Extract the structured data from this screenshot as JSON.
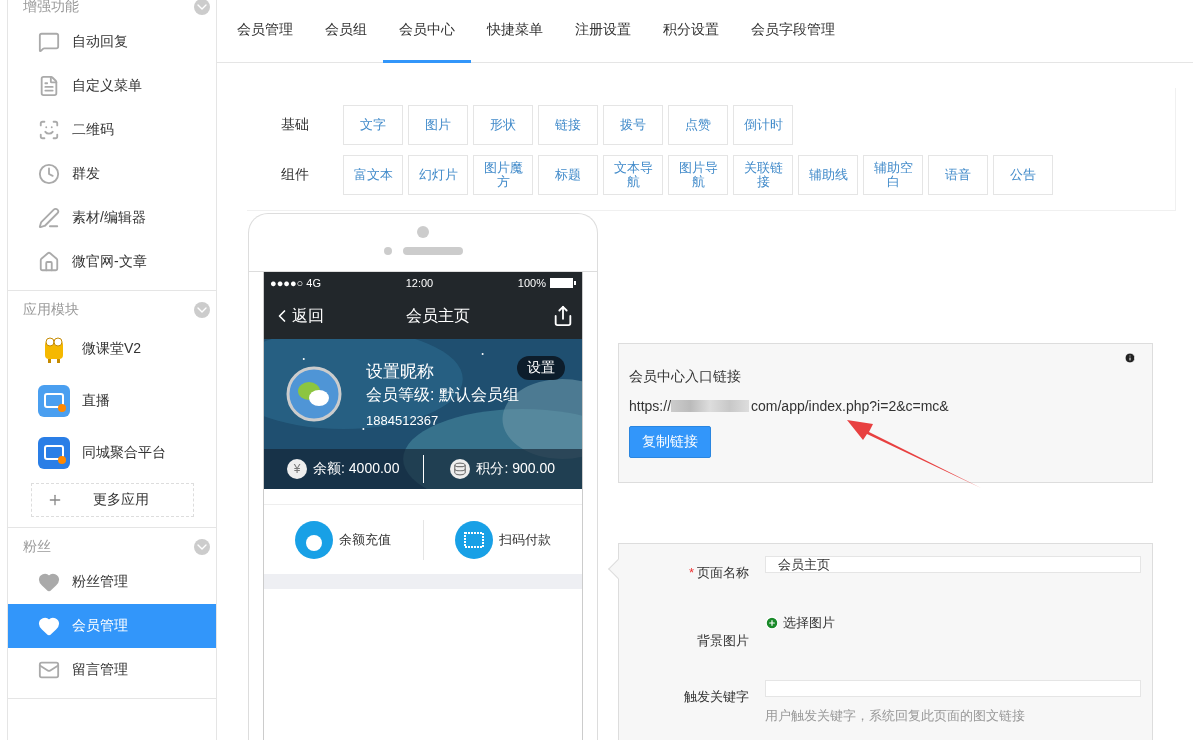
{
  "sidebar": {
    "sections": [
      {
        "title": "增强功能",
        "items": [
          {
            "kind": "menu",
            "label": "自动回复",
            "selected": false
          },
          {
            "kind": "menu",
            "label": "自定义菜单",
            "selected": false
          },
          {
            "kind": "menu",
            "label": "二维码",
            "selected": false
          },
          {
            "kind": "menu",
            "label": "群发",
            "selected": false
          },
          {
            "kind": "menu",
            "label": "素材/编辑器",
            "selected": false
          },
          {
            "kind": "menu",
            "label": "微官网-文章",
            "selected": false
          }
        ]
      },
      {
        "title": "应用模块",
        "items": [
          {
            "kind": "app",
            "label": "微课堂V2",
            "selected": false
          },
          {
            "kind": "app",
            "label": "直播",
            "selected": false
          },
          {
            "kind": "app",
            "label": "同城聚合平台",
            "selected": false
          },
          {
            "kind": "add",
            "label": "更多应用",
            "selected": false
          }
        ]
      },
      {
        "title": "粉丝",
        "items": [
          {
            "kind": "menu",
            "label": "粉丝管理",
            "selected": false
          },
          {
            "kind": "menu",
            "label": "会员管理",
            "selected": true
          },
          {
            "kind": "menu",
            "label": "留言管理",
            "selected": false
          }
        ]
      }
    ]
  },
  "tabs": [
    {
      "label": "会员管理",
      "selected": false
    },
    {
      "label": "会员组",
      "selected": false
    },
    {
      "label": "会员中心",
      "selected": true
    },
    {
      "label": "快捷菜单",
      "selected": false
    },
    {
      "label": "注册设置",
      "selected": false
    },
    {
      "label": "积分设置",
      "selected": false
    },
    {
      "label": "会员字段管理",
      "selected": false
    }
  ],
  "palette": [
    {
      "label": "基础",
      "items": [
        "文字",
        "图片",
        "形状",
        "链接",
        "拨号",
        "点赞",
        "倒计时"
      ]
    },
    {
      "label": "组件",
      "items": [
        "富文本",
        "幻灯片",
        "图片魔方",
        "标题",
        "文本导航",
        "图片导航",
        "关联链接",
        "辅助线",
        "辅助空白",
        "语音",
        "公告"
      ]
    }
  ],
  "phone": {
    "status": {
      "signal": "●●●●○ 4G",
      "time": "12:00",
      "battery": "100%"
    },
    "nav": {
      "back": "返回",
      "title": "会员主页"
    },
    "profile": {
      "nickname": "设置昵称",
      "level": "会员等级: 默认会员组",
      "phone": "1884512367",
      "settings": "设置"
    },
    "stats": [
      {
        "kind": "money",
        "icon": "¥",
        "text": "余额: 4000.00"
      },
      {
        "kind": "points",
        "text": "积分: 900.00"
      }
    ],
    "actions": [
      "余额充值",
      "扫码付款"
    ]
  },
  "link_box": {
    "title": "会员中心入口链接",
    "url_prefix": "https://",
    "url_suffix": "com/app/index.php?i=2&c=mc&",
    "button": "复制链接"
  },
  "form": [
    {
      "kind": "input",
      "label": "页面名称",
      "marker": "*",
      "value": "会员主页"
    },
    {
      "label": "背景图片",
      "action": "选择图片"
    },
    {
      "kind": "input",
      "label": "触发关键字",
      "help": "用户触发关键字，系统回复此页面的图文链接"
    }
  ]
}
